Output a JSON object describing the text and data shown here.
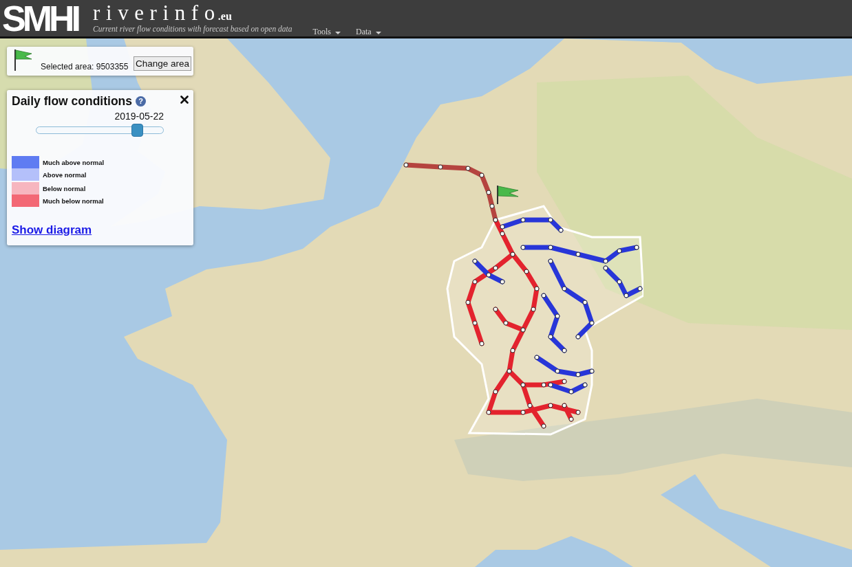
{
  "header": {
    "logo": "SMHI",
    "site_name": "riverinfo",
    "site_suffix": ".eu",
    "tagline": "Current river flow conditions with forecast based on open data",
    "menu": [
      {
        "label": "Tools"
      },
      {
        "label": "Data"
      }
    ]
  },
  "area_box": {
    "label": "Selected area: 9503355",
    "button": "Change area"
  },
  "flow_panel": {
    "title": "Daily flow conditions",
    "help": "?",
    "date": "2019-05-22",
    "slider": {
      "level": 0.8
    },
    "legend": [
      {
        "label": "Much above normal",
        "color": "#5f7cf2"
      },
      {
        "label": "Above normal",
        "color": "#b4c0fa"
      },
      {
        "label": "Below normal",
        "color": "#f7b6bf"
      },
      {
        "label": "Much below normal",
        "color": "#f36875"
      }
    ],
    "link": "Show diagram"
  }
}
